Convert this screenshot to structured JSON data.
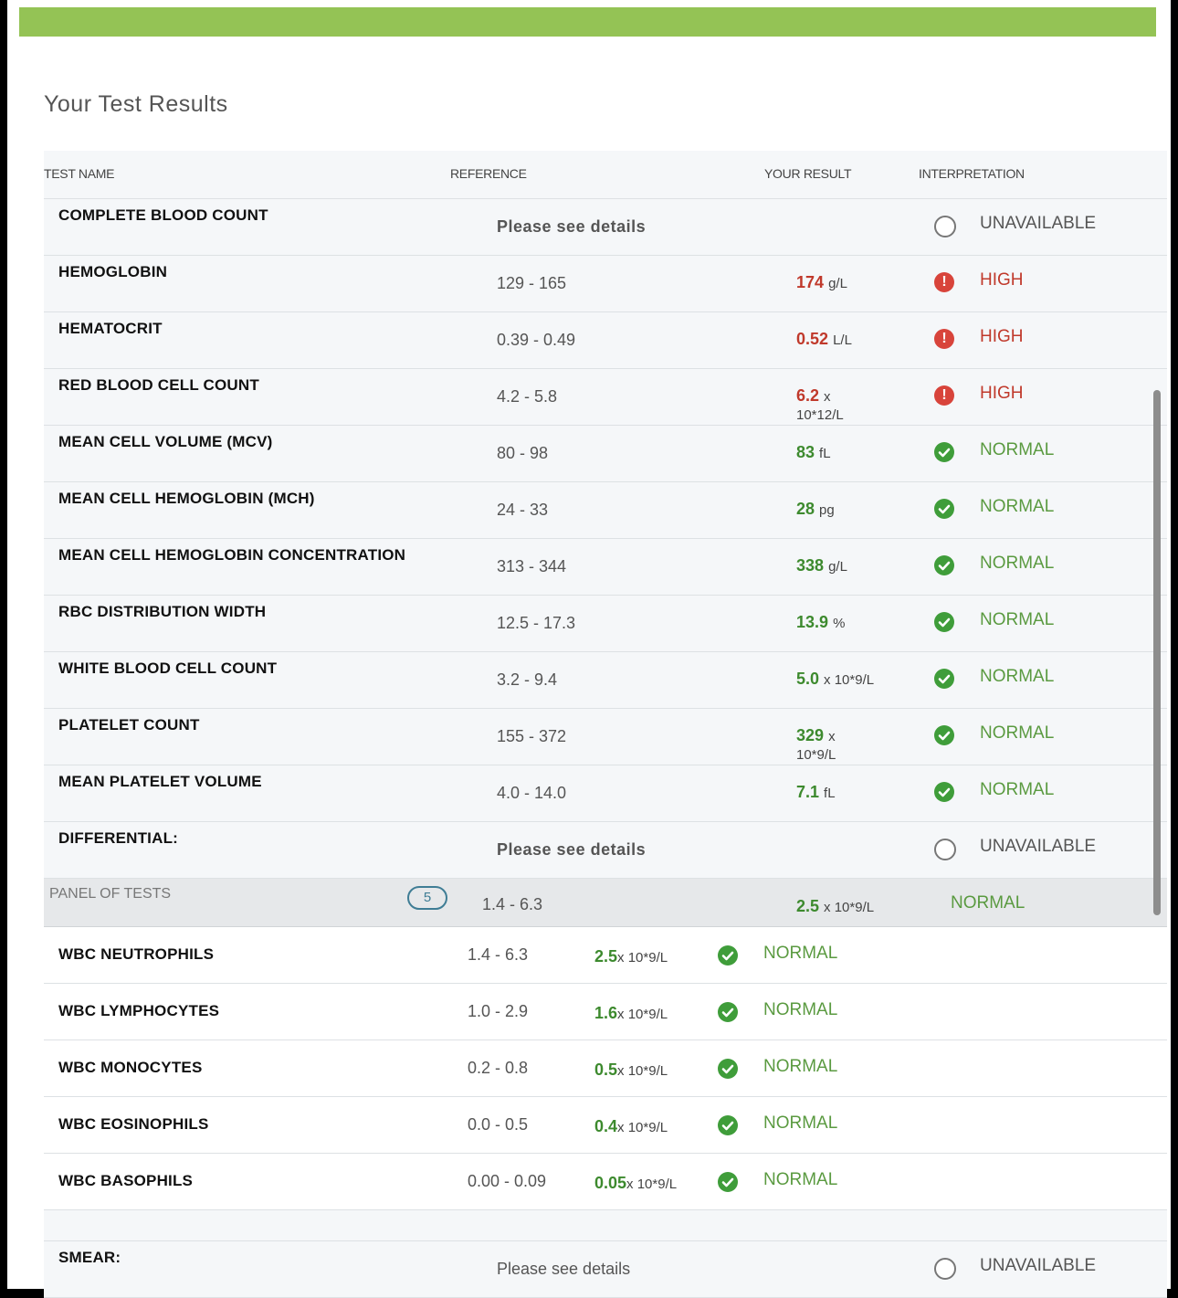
{
  "page": {
    "title": "Your Test Results"
  },
  "headers": {
    "test_name": "TEST NAME",
    "reference": "REFERENCE",
    "your_result": "YOUR RESULT",
    "interpretation": "INTERPRETATION"
  },
  "colors": {
    "accent_bar": "#94c355",
    "high": "#c0392b",
    "normal": "#3d8a2e"
  },
  "rows": [
    {
      "name": "COMPLETE BLOOD COUNT",
      "reference": "Please see details",
      "value": "",
      "unit": "",
      "interp": "UNAVAILABLE",
      "status": "unavailable"
    },
    {
      "name": "HEMOGLOBIN",
      "reference": "129 - 165",
      "value": "174",
      "unit": "g/L",
      "interp": "HIGH",
      "status": "high"
    },
    {
      "name": "HEMATOCRIT",
      "reference": "0.39 - 0.49",
      "value": "0.52",
      "unit": "L/L",
      "interp": "HIGH",
      "status": "high"
    },
    {
      "name": "RED BLOOD CELL COUNT",
      "reference": "4.2 - 5.8",
      "value": "6.2",
      "unit": "x",
      "unit2": "10*12/L",
      "interp": "HIGH",
      "status": "high"
    },
    {
      "name": "MEAN CELL VOLUME (MCV)",
      "reference": "80 - 98",
      "value": "83",
      "unit": "fL",
      "interp": "NORMAL",
      "status": "normal"
    },
    {
      "name": "MEAN CELL HEMOGLOBIN (MCH)",
      "reference": "24 - 33",
      "value": "28",
      "unit": "pg",
      "interp": "NORMAL",
      "status": "normal"
    },
    {
      "name": "MEAN CELL HEMOGLOBIN CONCENTRATION",
      "reference": "313 - 344",
      "value": "338",
      "unit": "g/L",
      "interp": "NORMAL",
      "status": "normal"
    },
    {
      "name": "RBC DISTRIBUTION WIDTH",
      "reference": "12.5 - 17.3",
      "value": "13.9",
      "unit": "%",
      "interp": "NORMAL",
      "status": "normal"
    },
    {
      "name": "WHITE BLOOD CELL COUNT",
      "reference": "3.2 - 9.4",
      "value": "5.0",
      "unit": "x 10*9/L",
      "interp": "NORMAL",
      "status": "normal"
    },
    {
      "name": "PLATELET COUNT",
      "reference": "155 - 372",
      "value": "329",
      "unit": "x",
      "unit2": "10*9/L",
      "interp": "NORMAL",
      "status": "normal"
    },
    {
      "name": "MEAN PLATELET VOLUME",
      "reference": "4.0 - 14.0",
      "value": "7.1",
      "unit": "fL",
      "interp": "NORMAL",
      "status": "normal"
    },
    {
      "name": "DIFFERENTIAL:",
      "reference": "Please see details",
      "value": "",
      "unit": "",
      "interp": "UNAVAILABLE",
      "status": "unavailable"
    }
  ],
  "panel": {
    "label": "PANEL OF TESTS",
    "count": "5",
    "reference": "1.4 - 6.3",
    "value": "2.5",
    "unit": "x 10*9/L",
    "interp": "NORMAL"
  },
  "sub_rows": [
    {
      "name": "WBC NEUTROPHILS",
      "reference": "1.4 - 6.3",
      "value": "2.5",
      "unit": "x 10*9/L",
      "interp": "NORMAL"
    },
    {
      "name": "WBC LYMPHOCYTES",
      "reference": "1.0 - 2.9",
      "value": "1.6",
      "unit": "x 10*9/L",
      "interp": "NORMAL"
    },
    {
      "name": "WBC MONOCYTES",
      "reference": "0.2 - 0.8",
      "value": "0.5",
      "unit": "x 10*9/L",
      "interp": "NORMAL"
    },
    {
      "name": "WBC EOSINOPHILS",
      "reference": "0.0 - 0.5",
      "value": "0.4",
      "unit": "x 10*9/L",
      "interp": "NORMAL"
    },
    {
      "name": "WBC BASOPHILS",
      "reference": "0.00 - 0.09",
      "value": "0.05",
      "unit": "x 10*9/L",
      "interp": "NORMAL"
    }
  ],
  "smear": {
    "name": "SMEAR:",
    "reference": "Please see details",
    "interp": "UNAVAILABLE"
  }
}
